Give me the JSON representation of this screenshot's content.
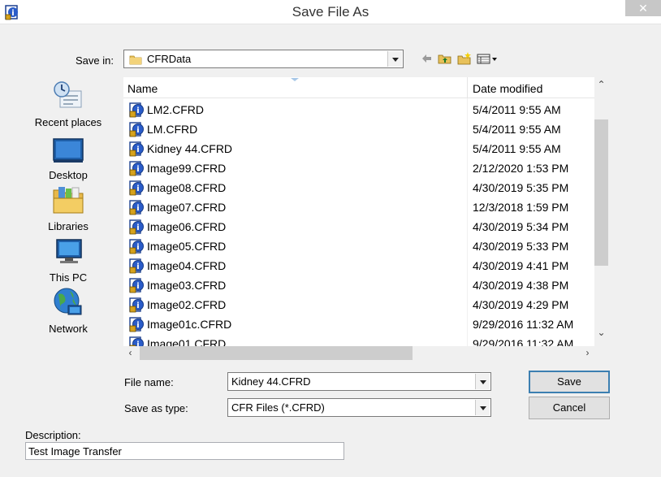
{
  "window": {
    "title": "Save File As",
    "close_icon": "close-icon"
  },
  "save_in": {
    "label": "Save in:",
    "value": "CFRData",
    "folder_icon": "folder-icon"
  },
  "toolbar": {
    "icons": [
      "back-arrow-icon",
      "up-folder-icon",
      "new-folder-icon",
      "view-menu-icon"
    ]
  },
  "places": [
    {
      "label": "Recent places",
      "icon": "recent-places-icon"
    },
    {
      "label": "Desktop",
      "icon": "desktop-icon"
    },
    {
      "label": "Libraries",
      "icon": "libraries-icon"
    },
    {
      "label": "This PC",
      "icon": "this-pc-icon"
    },
    {
      "label": "Network",
      "icon": "network-icon"
    }
  ],
  "file_list": {
    "columns": {
      "name": "Name",
      "date": "Date modified"
    },
    "rows": [
      {
        "name": "LM2.CFRD",
        "date": "5/4/2011 9:55 AM"
      },
      {
        "name": "LM.CFRD",
        "date": "5/4/2011 9:55 AM"
      },
      {
        "name": "Kidney 44.CFRD",
        "date": "5/4/2011 9:55 AM"
      },
      {
        "name": "Image99.CFRD",
        "date": "2/12/2020 1:53 PM"
      },
      {
        "name": "Image08.CFRD",
        "date": "4/30/2019 5:35 PM"
      },
      {
        "name": "Image07.CFRD",
        "date": "12/3/2018 1:59 PM"
      },
      {
        "name": "Image06.CFRD",
        "date": "4/30/2019 5:34 PM"
      },
      {
        "name": "Image05.CFRD",
        "date": "4/30/2019 5:33 PM"
      },
      {
        "name": "Image04.CFRD",
        "date": "4/30/2019 4:41 PM"
      },
      {
        "name": "Image03.CFRD",
        "date": "4/30/2019 4:38 PM"
      },
      {
        "name": "Image02.CFRD",
        "date": "4/30/2019 4:29 PM"
      },
      {
        "name": "Image01c.CFRD",
        "date": "9/29/2016 11:32 AM"
      },
      {
        "name": "Image01.CFRD",
        "date": "9/29/2016 11:32 AM"
      }
    ]
  },
  "file_name": {
    "label": "File name:",
    "value": "Kidney 44.CFRD"
  },
  "save_as_type": {
    "label": "Save as type:",
    "value": "CFR Files (*.CFRD)"
  },
  "buttons": {
    "save": "Save",
    "cancel": "Cancel"
  },
  "description": {
    "label": "Description:",
    "value": "Test Image Transfer"
  },
  "colors": {
    "accent": "#3c7fb1",
    "background": "#f0f0f0"
  }
}
